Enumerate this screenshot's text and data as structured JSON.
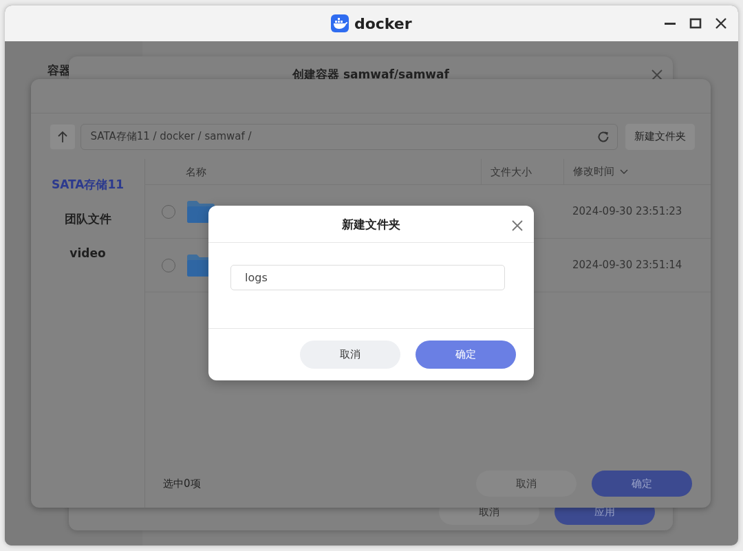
{
  "window": {
    "title": "docker"
  },
  "background": {
    "sidebar_heading": "容器"
  },
  "create_dialog": {
    "title": "创建容器 samwaf/samwaf",
    "buttons": [
      {
        "label": "取消",
        "kind": "secondary"
      },
      {
        "label": "应用",
        "kind": "primary"
      }
    ]
  },
  "file_picker": {
    "path": "SATA存储11 / docker / samwaf /",
    "new_folder_button": "新建文件夹",
    "locations": [
      {
        "label": "SATA存储11",
        "selected": true
      },
      {
        "label": "团队文件",
        "selected": false
      },
      {
        "label": "video",
        "selected": false
      }
    ],
    "columns": [
      {
        "label": "名称",
        "sorted": false
      },
      {
        "label": "文件大小",
        "sorted": false
      },
      {
        "label": "修改时间",
        "sorted": true
      }
    ],
    "rows": [
      {
        "selected": false,
        "modified": "2024-09-30 23:51:23"
      },
      {
        "selected": false,
        "modified": "2024-09-30 23:51:14"
      }
    ],
    "status": "选中0项",
    "buttons": [
      {
        "label": "取消",
        "kind": "secondary"
      },
      {
        "label": "确定",
        "kind": "primary"
      }
    ]
  },
  "new_folder_dialog": {
    "title": "新建文件夹",
    "value": "logs",
    "buttons": [
      {
        "label": "取消",
        "kind": "secondary"
      },
      {
        "label": "确定",
        "kind": "primary"
      }
    ]
  }
}
